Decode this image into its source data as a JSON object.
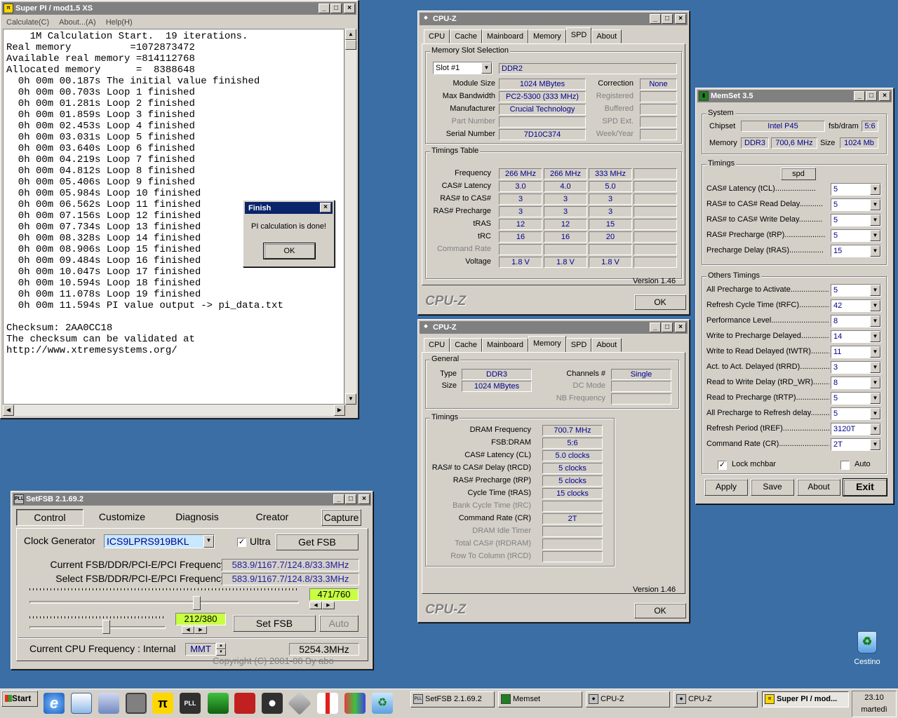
{
  "superpi": {
    "title": "Super PI / mod1.5 XS",
    "menu": [
      "Calculate(C)",
      "About...(A)",
      "Help(H)"
    ],
    "lines": [
      "    1M Calculation Start.  19 iterations.",
      "Real memory          =1072873472",
      "Available real memory =814112768",
      "Allocated memory      =  8388648",
      "  0h 00m 00.187s The initial value finished",
      "  0h 00m 00.703s Loop 1 finished",
      "  0h 00m 01.281s Loop 2 finished",
      "  0h 00m 01.859s Loop 3 finished",
      "  0h 00m 02.453s Loop 4 finished",
      "  0h 00m 03.031s Loop 5 finished",
      "  0h 00m 03.640s Loop 6 finished",
      "  0h 00m 04.219s Loop 7 finished",
      "  0h 00m 04.812s Loop 8 finished",
      "  0h 00m 05.406s Loop 9 finished",
      "  0h 00m 05.984s Loop 10 finished",
      "  0h 00m 06.562s Loop 11 finished",
      "  0h 00m 07.156s Loop 12 finished",
      "  0h 00m 07.734s Loop 13 finished",
      "  0h 00m 08.328s Loop 14 finished",
      "  0h 00m 08.906s Loop 15 finished",
      "  0h 00m 09.484s Loop 16 finished",
      "  0h 00m 10.047s Loop 17 finished",
      "  0h 00m 10.594s Loop 18 finished",
      "  0h 00m 11.078s Loop 19 finished",
      "  0h 00m 11.594s PI value output -> pi_data.txt",
      "",
      "Checksum: 2AA0CC18",
      "The checksum can be validated at",
      "http://www.xtremesystems.org/"
    ]
  },
  "finish": {
    "title": "Finish",
    "message": "PI calculation is done!",
    "ok": "OK"
  },
  "cpuz_common": {
    "tabs": [
      "CPU",
      "Cache",
      "Mainboard",
      "Memory",
      "SPD",
      "About"
    ],
    "version": "Version 1.46",
    "logo": "CPU-Z",
    "ok": "OK",
    "title": "CPU-Z"
  },
  "cpuz_spd": {
    "slot_group": "Memory Slot Selection",
    "slot": "Slot #1",
    "type": "DDR2",
    "module_size_label": "Module Size",
    "module_size": "1024 MBytes",
    "max_bw_label": "Max Bandwidth",
    "max_bw": "PC2-5300 (333 MHz)",
    "manuf_label": "Manufacturer",
    "manuf": "Crucial Technology",
    "part_label": "Part Number",
    "part": "",
    "serial_label": "Serial Number",
    "serial": "7D10C374",
    "correction_label": "Correction",
    "correction": "None",
    "registered_label": "Registered",
    "buffered_label": "Buffered",
    "spdext_label": "SPD Ext.",
    "weekyear_label": "Week/Year",
    "timings_group": "Timings Table",
    "rows": [
      {
        "label": "Frequency",
        "vals": [
          "266 MHz",
          "266 MHz",
          "333 MHz",
          ""
        ],
        "dis": false
      },
      {
        "label": "CAS# Latency",
        "vals": [
          "3.0",
          "4.0",
          "5.0",
          ""
        ],
        "dis": false
      },
      {
        "label": "RAS# to CAS#",
        "vals": [
          "3",
          "3",
          "3",
          ""
        ],
        "dis": false
      },
      {
        "label": "RAS# Precharge",
        "vals": [
          "3",
          "3",
          "3",
          ""
        ],
        "dis": false
      },
      {
        "label": "tRAS",
        "vals": [
          "12",
          "12",
          "15",
          ""
        ],
        "dis": false
      },
      {
        "label": "tRC",
        "vals": [
          "16",
          "16",
          "20",
          ""
        ],
        "dis": false
      },
      {
        "label": "Command Rate",
        "vals": [
          "",
          "",
          "",
          ""
        ],
        "dis": true
      },
      {
        "label": "Voltage",
        "vals": [
          "1.8 V",
          "1.8 V",
          "1.8 V",
          ""
        ],
        "dis": false
      }
    ]
  },
  "cpuz_mem": {
    "general_group": "General",
    "type_label": "Type",
    "type": "DDR3",
    "size_label": "Size",
    "size": "1024 MBytes",
    "channels_label": "Channels #",
    "channels": "Single",
    "dcmode_label": "DC Mode",
    "nbfreq_label": "NB Frequency",
    "timings_group": "Timings",
    "rows": [
      {
        "label": "DRAM Frequency",
        "val": "700.7 MHz",
        "dis": false
      },
      {
        "label": "FSB:DRAM",
        "val": "5:6",
        "dis": false
      },
      {
        "label": "CAS# Latency (CL)",
        "val": "5.0 clocks",
        "dis": false
      },
      {
        "label": "RAS# to CAS# Delay (tRCD)",
        "val": "5 clocks",
        "dis": false
      },
      {
        "label": "RAS# Precharge (tRP)",
        "val": "5 clocks",
        "dis": false
      },
      {
        "label": "Cycle Time (tRAS)",
        "val": "15 clocks",
        "dis": false
      },
      {
        "label": "Bank Cycle Time (tRC)",
        "val": "",
        "dis": true
      },
      {
        "label": "Command Rate (CR)",
        "val": "2T",
        "dis": false
      },
      {
        "label": "DRAM Idle Timer",
        "val": "",
        "dis": true
      },
      {
        "label": "Total CAS# (tRDRAM)",
        "val": "",
        "dis": true
      },
      {
        "label": "Row To Column (tRCD)",
        "val": "",
        "dis": true
      }
    ]
  },
  "memset": {
    "title": "MemSet 3.5",
    "system_group": "System",
    "chipset_label": "Chipset",
    "chipset": "Intel P45",
    "fsbdram_label": "fsb/dram",
    "fsbdram": "5:6",
    "memory_label": "Memory",
    "mem_type": "DDR3",
    "mem_freq": "700,6 MHz",
    "size_label": "Size",
    "size": "1024 Mb",
    "timings_group": "Timings",
    "spd_btn": "spd",
    "timings": [
      {
        "label": "CAS# Latency (tCL)...................",
        "val": "5"
      },
      {
        "label": "RAS# to CAS# Read Delay...........",
        "val": "5"
      },
      {
        "label": "RAS# to CAS# Write Delay...........",
        "val": "5"
      },
      {
        "label": "RAS# Precharge (tRP)...................",
        "val": "5"
      },
      {
        "label": "Precharge Delay  (tRAS)................",
        "val": "15"
      }
    ],
    "others_group": "Others Timings",
    "others": [
      {
        "label": "All Precharge to Activate..................",
        "val": "5"
      },
      {
        "label": "Refresh Cycle Time (tRFC)...............",
        "val": "42"
      },
      {
        "label": "Performance Level.............................",
        "val": "8"
      },
      {
        "label": "Write to Precharge Delayed.............",
        "val": "14"
      },
      {
        "label": "Write to Read Delayed (tWTR).........",
        "val": "11"
      },
      {
        "label": "Act. to Act. Delayed (tRRD)..............",
        "val": "3"
      },
      {
        "label": "Read to Write Delay (tRD_WR).........",
        "val": "8"
      },
      {
        "label": "Read to Precharge (tRTP)................",
        "val": "5"
      },
      {
        "label": "All Precharge to Refresh delay.........",
        "val": "5"
      },
      {
        "label": "Refresh Period (tREF)......................",
        "val": "3120T"
      },
      {
        "label": "Command Rate (CR)...........................",
        "val": "2T"
      }
    ],
    "lock_label": "Lock mchbar",
    "auto_label": "Auto",
    "apply": "Apply",
    "save": "Save",
    "about": "About",
    "exit": "Exit"
  },
  "setfsb": {
    "title": "SetFSB 2.1.69.2",
    "tabs": [
      "Control",
      "Customize",
      "Diagnosis",
      "Creator",
      "Capture"
    ],
    "clockgen_label": "Clock Generator",
    "clockgen": "ICS9LPRS919BKL",
    "ultra_label": "Ultra",
    "getfsb": "Get FSB",
    "current_label": "Current FSB/DDR/PCI-E/PCI Frequency",
    "current": "583.9/1167.7/124.8/33.3MHz",
    "select_label": "Select FSB/DDR/PCI-E/PCI Frequency",
    "select": "583.9/1167.7/124.8/33.3MHz",
    "slider1": "471/760",
    "slider1_frac": 0.62,
    "slider2": "212/380",
    "slider2_frac": 0.56,
    "setfsb": "Set FSB",
    "auto": "Auto",
    "cpu_label": "Current CPU Frequency : Internal",
    "mmt": "MMT",
    "cpu_freq": "5254.3MHz",
    "copyright": "Copyright (C) 2001-08 By abo"
  },
  "desktop": {
    "recycle": "Cestino"
  },
  "taskbar": {
    "start": "Start",
    "tasks": [
      "SetFSB 2.1.69.2",
      "Memset",
      "CPU-Z",
      "CPU-Z",
      "Super PI / mod..."
    ],
    "time": "23.10",
    "day": "martedì"
  }
}
